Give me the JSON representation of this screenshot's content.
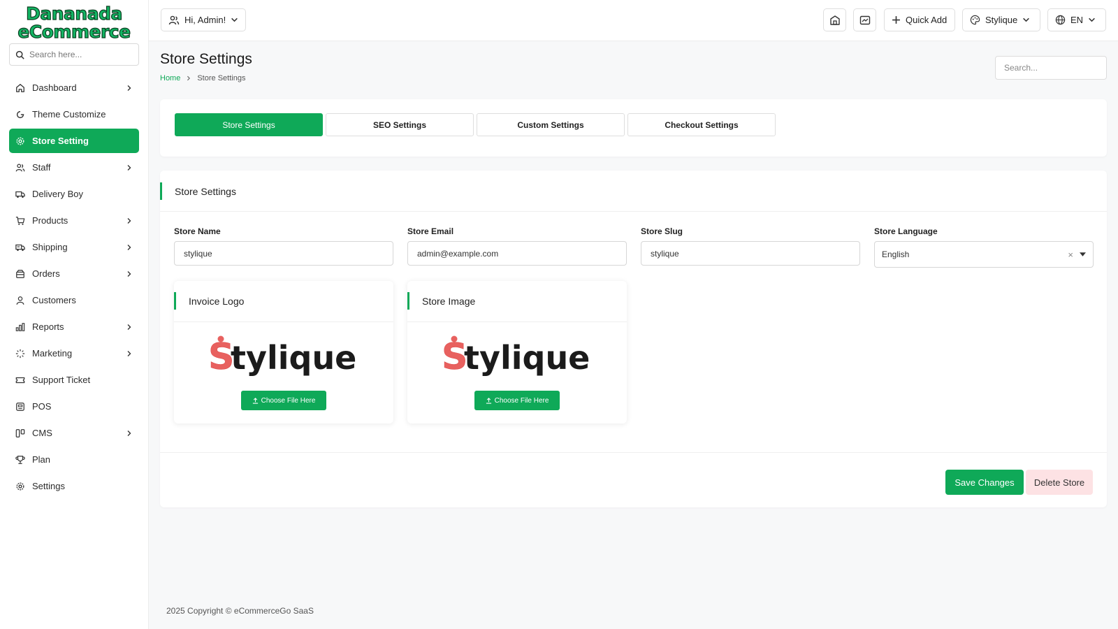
{
  "brand": {
    "line1": "Dananada",
    "line2": "eCommerce",
    "accent": "#0fa958"
  },
  "sidebar": {
    "search_placeholder": "Search here...",
    "items": [
      {
        "label": "Dashboard",
        "icon": "home-icon",
        "chevron": true
      },
      {
        "label": "Theme Customize",
        "icon": "theme-icon",
        "chevron": false
      },
      {
        "label": "Store Setting",
        "icon": "gear-icon",
        "chevron": false,
        "active": true
      },
      {
        "label": "Staff",
        "icon": "users-icon",
        "chevron": true
      },
      {
        "label": "Delivery Boy",
        "icon": "truck-icon",
        "chevron": false
      },
      {
        "label": "Products",
        "icon": "cart-icon",
        "chevron": true
      },
      {
        "label": "Shipping",
        "icon": "shipping-icon",
        "chevron": true
      },
      {
        "label": "Orders",
        "icon": "box-icon",
        "chevron": true
      },
      {
        "label": "Customers",
        "icon": "user-icon",
        "chevron": false
      },
      {
        "label": "Reports",
        "icon": "chart-icon",
        "chevron": true
      },
      {
        "label": "Marketing",
        "icon": "sparkle-icon",
        "chevron": true
      },
      {
        "label": "Support Ticket",
        "icon": "ticket-icon",
        "chevron": false
      },
      {
        "label": "POS",
        "icon": "pos-icon",
        "chevron": false
      },
      {
        "label": "CMS",
        "icon": "layout-icon",
        "chevron": true
      },
      {
        "label": "Plan",
        "icon": "trophy-icon",
        "chevron": false
      },
      {
        "label": "Settings",
        "icon": "settings-icon",
        "chevron": false
      }
    ]
  },
  "topbar": {
    "greeting": "Hi, Admin!",
    "quick_add": "Quick Add",
    "theme": "Stylique",
    "language": "EN"
  },
  "page": {
    "title": "Store Settings",
    "breadcrumb": {
      "home": "Home",
      "current": "Store Settings"
    },
    "search_placeholder": "Search..."
  },
  "tabs": [
    {
      "label": "Store Settings",
      "active": true
    },
    {
      "label": "SEO Settings"
    },
    {
      "label": "Custom Settings"
    },
    {
      "label": "Checkout Settings"
    }
  ],
  "form": {
    "section_title": "Store Settings",
    "store_name": {
      "label": "Store Name",
      "value": "stylique"
    },
    "store_email": {
      "label": "Store Email",
      "value": "admin@example.com"
    },
    "store_slug": {
      "label": "Store Slug",
      "value": "stylique"
    },
    "store_language": {
      "label": "Store Language",
      "value": "English"
    },
    "invoice_logo": {
      "title": "Invoice Logo",
      "logo_text": "Stylique",
      "button": "Choose File Here"
    },
    "store_image": {
      "title": "Store Image",
      "logo_text": "Stylique",
      "button": "Choose File Here"
    },
    "save_label": "Save Changes",
    "delete_label": "Delete Store"
  },
  "footer": {
    "text": "2025 Copyright © eCommerceGo SaaS"
  }
}
